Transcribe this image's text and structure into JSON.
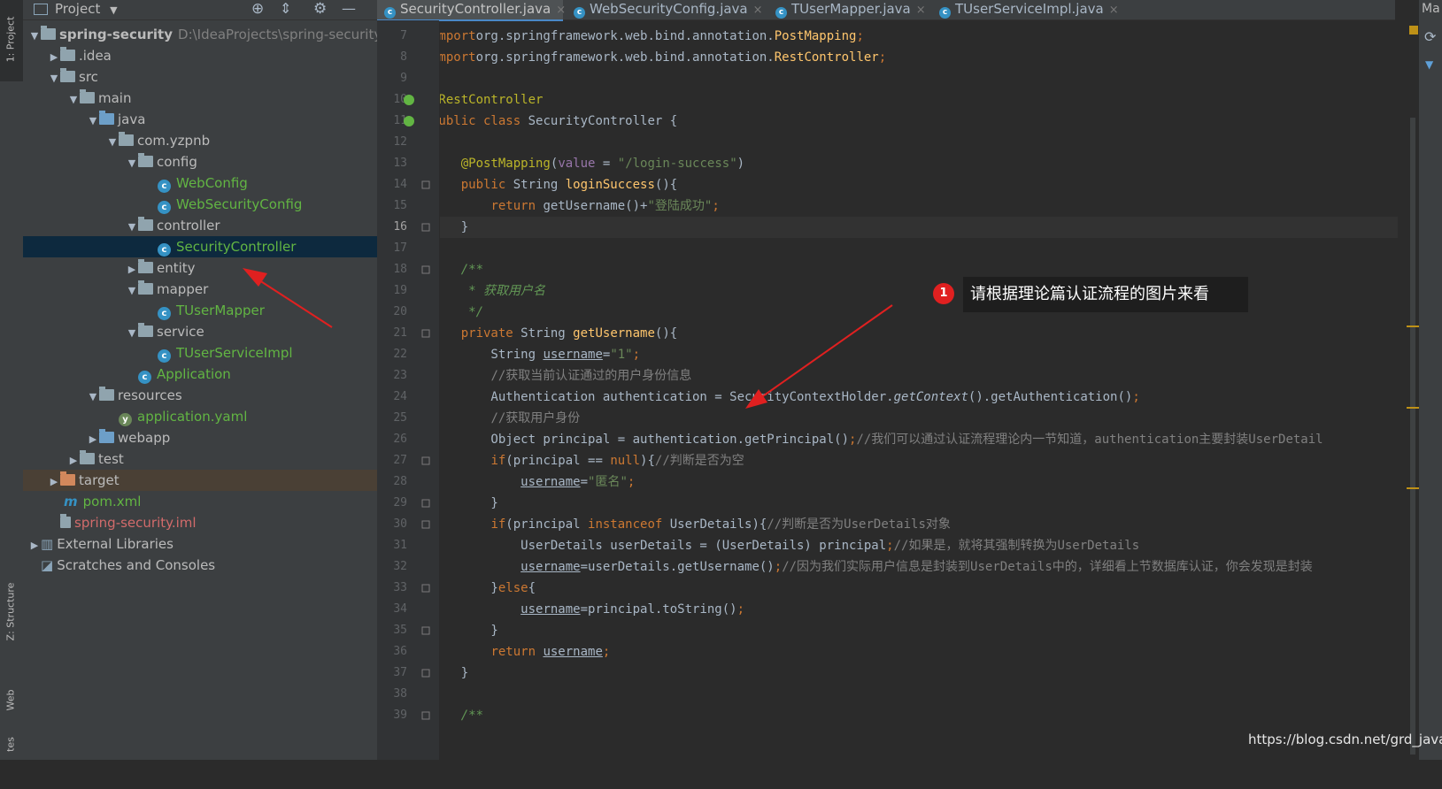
{
  "left_strip": {
    "project_tab": "1: Project",
    "structure_tab": "Z: Structure",
    "web_tab": "Web",
    "favorites_tab": "tes"
  },
  "project_panel": {
    "title": "Project",
    "tree": [
      {
        "indent": 0,
        "arrow": "▼",
        "icon": "folder",
        "label": "spring-security",
        "path": "D:\\IdeaProjects\\spring-security",
        "bold": true
      },
      {
        "indent": 1,
        "arrow": "▶",
        "icon": "folder",
        "label": ".idea"
      },
      {
        "indent": 1,
        "arrow": "▼",
        "icon": "folder",
        "label": "src"
      },
      {
        "indent": 2,
        "arrow": "▼",
        "icon": "folder",
        "label": "main"
      },
      {
        "indent": 3,
        "arrow": "▼",
        "icon": "folder-blue",
        "label": "java"
      },
      {
        "indent": 4,
        "arrow": "▼",
        "icon": "folder",
        "label": "com.yzpnb"
      },
      {
        "indent": 5,
        "arrow": "▼",
        "icon": "folder",
        "label": "config"
      },
      {
        "indent": 6,
        "arrow": "",
        "icon": "class",
        "label": "WebConfig",
        "color": "green"
      },
      {
        "indent": 6,
        "arrow": "",
        "icon": "class",
        "label": "WebSecurityConfig",
        "color": "green"
      },
      {
        "indent": 5,
        "arrow": "▼",
        "icon": "folder",
        "label": "controller"
      },
      {
        "indent": 6,
        "arrow": "",
        "icon": "class",
        "label": "SecurityController",
        "color": "green",
        "selected": true
      },
      {
        "indent": 5,
        "arrow": "▶",
        "icon": "folder",
        "label": "entity"
      },
      {
        "indent": 5,
        "arrow": "▼",
        "icon": "folder",
        "label": "mapper"
      },
      {
        "indent": 6,
        "arrow": "",
        "icon": "class",
        "label": "TUserMapper",
        "color": "green"
      },
      {
        "indent": 5,
        "arrow": "▼",
        "icon": "folder",
        "label": "service"
      },
      {
        "indent": 6,
        "arrow": "",
        "icon": "class",
        "label": "TUserServiceImpl",
        "color": "green"
      },
      {
        "indent": 5,
        "arrow": "",
        "icon": "class",
        "label": "Application",
        "color": "green"
      },
      {
        "indent": 3,
        "arrow": "▼",
        "icon": "folder",
        "label": "resources"
      },
      {
        "indent": 4,
        "arrow": "",
        "icon": "yaml",
        "label": "application.yaml",
        "color": "green"
      },
      {
        "indent": 3,
        "arrow": "▶",
        "icon": "folder-blue",
        "label": "webapp"
      },
      {
        "indent": 2,
        "arrow": "▶",
        "icon": "folder",
        "label": "test"
      },
      {
        "indent": 1,
        "arrow": "▶",
        "icon": "folder-orange",
        "label": "target",
        "target": true
      },
      {
        "indent": 1,
        "arrow": "",
        "icon": "maven",
        "label": "pom.xml",
        "color": "green"
      },
      {
        "indent": 1,
        "arrow": "",
        "icon": "iml",
        "label": "spring-security.iml",
        "color": "red"
      },
      {
        "indent": 0,
        "arrow": "▶",
        "icon": "libraries",
        "label": "External Libraries"
      },
      {
        "indent": 0,
        "arrow": "",
        "icon": "scratches",
        "label": "Scratches and Consoles"
      }
    ]
  },
  "editor_tabs": [
    {
      "label": "SecurityController.java",
      "active": true
    },
    {
      "label": "WebSecurityConfig.java",
      "active": false
    },
    {
      "label": "TUserMapper.java",
      "active": false
    },
    {
      "label": "TUserServiceImpl.java",
      "active": false
    }
  ],
  "right_strip": {
    "label": "Ma"
  },
  "code_lines": [
    {
      "num": "7",
      "tokens": [
        [
          "kw",
          "import"
        ],
        [
          "",
          "org.springframework.web.bind.annotation."
        ],
        [
          "fn",
          "PostMapping"
        ],
        [
          "kw",
          ";"
        ]
      ]
    },
    {
      "num": "8",
      "tokens": [
        [
          "kw",
          "import"
        ],
        [
          "",
          "org.springframework.web.bind.annotation."
        ],
        [
          "fn",
          "RestController"
        ],
        [
          "kw",
          ";"
        ]
      ]
    },
    {
      "num": "9",
      "tokens": []
    },
    {
      "num": "10",
      "tokens": [
        [
          "ann",
          "@RestController"
        ]
      ]
    },
    {
      "num": "11",
      "tokens": [
        [
          "kw",
          "public class"
        ],
        [
          "",
          " SecurityController {"
        ]
      ]
    },
    {
      "num": "12",
      "tokens": []
    },
    {
      "num": "13",
      "tokens": [
        [
          "",
          "    "
        ],
        [
          "ann",
          "@PostMapping"
        ],
        [
          "",
          "("
        ],
        [
          "fld",
          "value"
        ],
        [
          "",
          " = "
        ],
        [
          "str",
          "\"/login-success\""
        ],
        [
          "",
          ")"
        ]
      ]
    },
    {
      "num": "14",
      "tokens": [
        [
          "",
          "    "
        ],
        [
          "kw",
          "public"
        ],
        [
          "",
          " String "
        ],
        [
          "fn",
          "loginSuccess"
        ],
        [
          "",
          "(){"
        ]
      ]
    },
    {
      "num": "15",
      "tokens": [
        [
          "",
          "        "
        ],
        [
          "kw",
          "return"
        ],
        [
          "",
          " getUsername()+"
        ],
        [
          "str",
          "\"登陆成功\""
        ],
        [
          "kw",
          ";"
        ]
      ]
    },
    {
      "num": "16",
      "tokens": [
        [
          "",
          "    }"
        ]
      ],
      "current": true
    },
    {
      "num": "17",
      "tokens": []
    },
    {
      "num": "18",
      "tokens": [
        [
          "",
          "    "
        ],
        [
          "doc",
          "/**"
        ]
      ]
    },
    {
      "num": "19",
      "tokens": [
        [
          "",
          "     "
        ],
        [
          "doc",
          "* 获取用户名"
        ]
      ]
    },
    {
      "num": "20",
      "tokens": [
        [
          "",
          "     "
        ],
        [
          "doc",
          "*/"
        ]
      ]
    },
    {
      "num": "21",
      "tokens": [
        [
          "",
          "    "
        ],
        [
          "kw",
          "private"
        ],
        [
          "",
          " String "
        ],
        [
          "fn",
          "getUsername"
        ],
        [
          "",
          "(){"
        ]
      ]
    },
    {
      "num": "22",
      "tokens": [
        [
          "",
          "        String "
        ],
        [
          "u",
          "username"
        ],
        [
          "",
          "="
        ],
        [
          "str",
          "\"1\""
        ],
        [
          "kw",
          ";"
        ]
      ]
    },
    {
      "num": "23",
      "tokens": [
        [
          "",
          "        "
        ],
        [
          "cmt",
          "//获取当前认证通过的用户身份信息"
        ]
      ]
    },
    {
      "num": "24",
      "tokens": [
        [
          "",
          "        Authentication authentication = SecurityContextHolder."
        ],
        [
          "ital",
          "getContext"
        ],
        [
          "",
          "().getAuthentication()"
        ],
        [
          "kw",
          ";"
        ]
      ]
    },
    {
      "num": "25",
      "tokens": [
        [
          "",
          "        "
        ],
        [
          "cmt",
          "//获取用户身份"
        ]
      ]
    },
    {
      "num": "26",
      "tokens": [
        [
          "",
          "        Object principal = authentication.getPrincipal()"
        ],
        [
          "kw",
          ";"
        ],
        [
          "cmt",
          "//我们可以通过认证流程理论内一节知道，authentication主要封装UserDetail"
        ]
      ]
    },
    {
      "num": "27",
      "tokens": [
        [
          "",
          "        "
        ],
        [
          "kw",
          "if"
        ],
        [
          "",
          "(principal == "
        ],
        [
          "kw",
          "null"
        ],
        [
          "",
          "){"
        ],
        [
          "cmt",
          "//判断是否为空"
        ]
      ]
    },
    {
      "num": "28",
      "tokens": [
        [
          "",
          "            "
        ],
        [
          "u",
          "username"
        ],
        [
          "",
          "="
        ],
        [
          "str",
          "\"匿名\""
        ],
        [
          "kw",
          ";"
        ]
      ]
    },
    {
      "num": "29",
      "tokens": [
        [
          "",
          "        }"
        ]
      ]
    },
    {
      "num": "30",
      "tokens": [
        [
          "",
          "        "
        ],
        [
          "kw",
          "if"
        ],
        [
          "",
          "(principal "
        ],
        [
          "kw",
          "instanceof"
        ],
        [
          "",
          " UserDetails){"
        ],
        [
          "cmt",
          "//判断是否为UserDetails对象"
        ]
      ]
    },
    {
      "num": "31",
      "tokens": [
        [
          "",
          "            UserDetails userDetails = (UserDetails) principal"
        ],
        [
          "kw",
          ";"
        ],
        [
          "cmt",
          "//如果是，就将其强制转换为UserDetails"
        ]
      ]
    },
    {
      "num": "32",
      "tokens": [
        [
          "",
          "            "
        ],
        [
          "u",
          "username"
        ],
        [
          "",
          "=userDetails.getUsername()"
        ],
        [
          "kw",
          ";"
        ],
        [
          "cmt",
          "//因为我们实际用户信息是封装到UserDetails中的，详细看上节数据库认证，你会发现是封装"
        ]
      ]
    },
    {
      "num": "33",
      "tokens": [
        [
          "",
          "        }"
        ],
        [
          "kw",
          "else"
        ],
        [
          "",
          "{"
        ]
      ]
    },
    {
      "num": "34",
      "tokens": [
        [
          "",
          "            "
        ],
        [
          "u",
          "username"
        ],
        [
          "",
          "=principal.toString()"
        ],
        [
          "kw",
          ";"
        ]
      ]
    },
    {
      "num": "35",
      "tokens": [
        [
          "",
          "        }"
        ]
      ]
    },
    {
      "num": "36",
      "tokens": [
        [
          "",
          "        "
        ],
        [
          "kw",
          "return"
        ],
        [
          "",
          " "
        ],
        [
          "u",
          "username"
        ],
        [
          "kw",
          ";"
        ]
      ]
    },
    {
      "num": "37",
      "tokens": [
        [
          "",
          "    }"
        ]
      ]
    },
    {
      "num": "38",
      "tokens": []
    },
    {
      "num": "39",
      "tokens": [
        [
          "",
          "    "
        ],
        [
          "doc",
          "/**"
        ]
      ]
    }
  ],
  "callout": {
    "number": "1",
    "text": "请根据理论篇认证流程的图片来看"
  },
  "watermark": "https://blog.csdn.net/grd_java",
  "colors": {
    "accent": "#4a88c7",
    "annotation_red": "#e02020"
  }
}
